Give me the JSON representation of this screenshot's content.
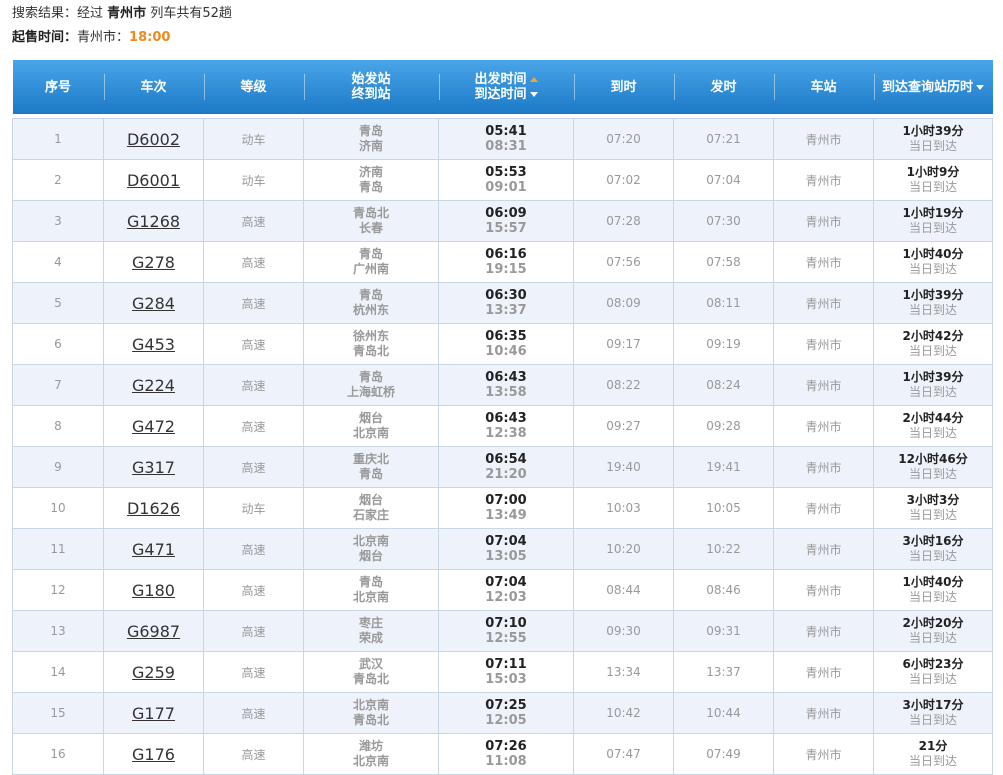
{
  "summary": {
    "prefix": "搜索结果：经过",
    "city": "青州市",
    "suffix": "列车共有52趟"
  },
  "sale": {
    "label": "起售时间：",
    "city": "青州市：",
    "time": "18:00"
  },
  "headers": {
    "index": "序号",
    "train": "车次",
    "grade": "等级",
    "from": "始发站",
    "to": "终到站",
    "dep": "出发时间",
    "arr": "到达时间",
    "arrive_at": "到时",
    "depart_at": "发时",
    "station": "车站",
    "duration": "到达查询站历时"
  },
  "rows": [
    {
      "index": "1",
      "train": "D6002",
      "grade": "动车",
      "from": "青岛",
      "to": "济南",
      "dep": "05:41",
      "arr": "08:31",
      "arrive_at": "07:20",
      "depart_at": "07:21",
      "station": "青州市",
      "duration": "1小时39分",
      "day": "当日到达"
    },
    {
      "index": "2",
      "train": "D6001",
      "grade": "动车",
      "from": "济南",
      "to": "青岛",
      "dep": "05:53",
      "arr": "09:01",
      "arrive_at": "07:02",
      "depart_at": "07:04",
      "station": "青州市",
      "duration": "1小时9分",
      "day": "当日到达"
    },
    {
      "index": "3",
      "train": "G1268",
      "grade": "高速",
      "from": "青岛北",
      "to": "长春",
      "dep": "06:09",
      "arr": "15:57",
      "arrive_at": "07:28",
      "depart_at": "07:30",
      "station": "青州市",
      "duration": "1小时19分",
      "day": "当日到达"
    },
    {
      "index": "4",
      "train": "G278",
      "grade": "高速",
      "from": "青岛",
      "to": "广州南",
      "dep": "06:16",
      "arr": "19:15",
      "arrive_at": "07:56",
      "depart_at": "07:58",
      "station": "青州市",
      "duration": "1小时40分",
      "day": "当日到达"
    },
    {
      "index": "5",
      "train": "G284",
      "grade": "高速",
      "from": "青岛",
      "to": "杭州东",
      "dep": "06:30",
      "arr": "13:37",
      "arrive_at": "08:09",
      "depart_at": "08:11",
      "station": "青州市",
      "duration": "1小时39分",
      "day": "当日到达"
    },
    {
      "index": "6",
      "train": "G453",
      "grade": "高速",
      "from": "徐州东",
      "to": "青岛北",
      "dep": "06:35",
      "arr": "10:46",
      "arrive_at": "09:17",
      "depart_at": "09:19",
      "station": "青州市",
      "duration": "2小时42分",
      "day": "当日到达"
    },
    {
      "index": "7",
      "train": "G224",
      "grade": "高速",
      "from": "青岛",
      "to": "上海虹桥",
      "dep": "06:43",
      "arr": "13:58",
      "arrive_at": "08:22",
      "depart_at": "08:24",
      "station": "青州市",
      "duration": "1小时39分",
      "day": "当日到达"
    },
    {
      "index": "8",
      "train": "G472",
      "grade": "高速",
      "from": "烟台",
      "to": "北京南",
      "dep": "06:43",
      "arr": "12:38",
      "arrive_at": "09:27",
      "depart_at": "09:28",
      "station": "青州市",
      "duration": "2小时44分",
      "day": "当日到达"
    },
    {
      "index": "9",
      "train": "G317",
      "grade": "高速",
      "from": "重庆北",
      "to": "青岛",
      "dep": "06:54",
      "arr": "21:20",
      "arrive_at": "19:40",
      "depart_at": "19:41",
      "station": "青州市",
      "duration": "12小时46分",
      "day": "当日到达"
    },
    {
      "index": "10",
      "train": "D1626",
      "grade": "动车",
      "from": "烟台",
      "to": "石家庄",
      "dep": "07:00",
      "arr": "13:49",
      "arrive_at": "10:03",
      "depart_at": "10:05",
      "station": "青州市",
      "duration": "3小时3分",
      "day": "当日到达"
    },
    {
      "index": "11",
      "train": "G471",
      "grade": "高速",
      "from": "北京南",
      "to": "烟台",
      "dep": "07:04",
      "arr": "13:05",
      "arrive_at": "10:20",
      "depart_at": "10:22",
      "station": "青州市",
      "duration": "3小时16分",
      "day": "当日到达"
    },
    {
      "index": "12",
      "train": "G180",
      "grade": "高速",
      "from": "青岛",
      "to": "北京南",
      "dep": "07:04",
      "arr": "12:03",
      "arrive_at": "08:44",
      "depart_at": "08:46",
      "station": "青州市",
      "duration": "1小时40分",
      "day": "当日到达"
    },
    {
      "index": "13",
      "train": "G6987",
      "grade": "高速",
      "from": "枣庄",
      "to": "荣成",
      "dep": "07:10",
      "arr": "12:55",
      "arrive_at": "09:30",
      "depart_at": "09:31",
      "station": "青州市",
      "duration": "2小时20分",
      "day": "当日到达"
    },
    {
      "index": "14",
      "train": "G259",
      "grade": "高速",
      "from": "武汉",
      "to": "青岛北",
      "dep": "07:11",
      "arr": "15:03",
      "arrive_at": "13:34",
      "depart_at": "13:37",
      "station": "青州市",
      "duration": "6小时23分",
      "day": "当日到达"
    },
    {
      "index": "15",
      "train": "G177",
      "grade": "高速",
      "from": "北京南",
      "to": "青岛北",
      "dep": "07:25",
      "arr": "12:05",
      "arrive_at": "10:42",
      "depart_at": "10:44",
      "station": "青州市",
      "duration": "3小时17分",
      "day": "当日到达"
    },
    {
      "index": "16",
      "train": "G176",
      "grade": "高速",
      "from": "潍坊",
      "to": "北京南",
      "dep": "07:26",
      "arr": "11:08",
      "arrive_at": "07:47",
      "depart_at": "07:49",
      "station": "青州市",
      "duration": "21分",
      "day": "当日到达"
    }
  ]
}
